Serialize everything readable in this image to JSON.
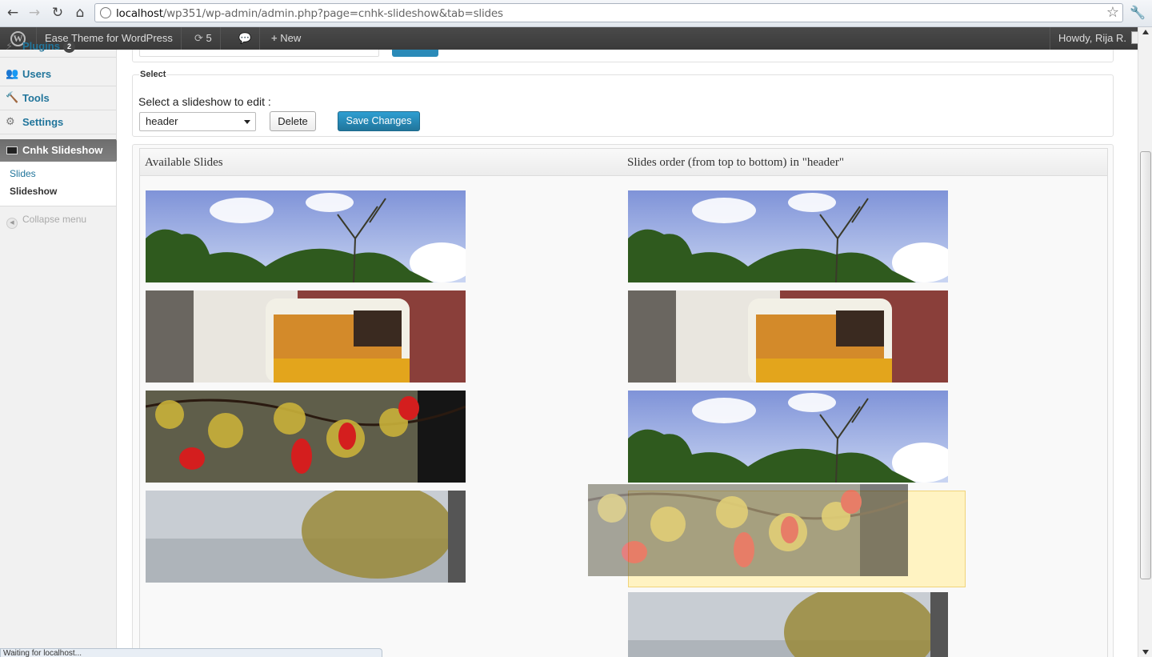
{
  "browser": {
    "url_host": "localhost",
    "url_rest": "/wp351/wp-admin/admin.php?page=cnhk-slideshow&tab=slides",
    "back_icon": "back-arrow-icon",
    "forward_icon": "forward-arrow-icon",
    "status": "Waiting for localhost..."
  },
  "adminbar": {
    "site_name": "Ease Theme for WordPress",
    "updates_count": "5",
    "new_label": "New",
    "howdy": "Howdy, Rija R."
  },
  "sidebar": {
    "items": [
      {
        "label": "Plugins",
        "badge": "2",
        "icon": "plugin-icon"
      },
      {
        "label": "Users",
        "icon": "users-icon"
      },
      {
        "label": "Tools",
        "icon": "tools-icon"
      },
      {
        "label": "Settings",
        "icon": "settings-icon"
      }
    ],
    "current": "Cnhk Slideshow",
    "submenu": [
      "Slides",
      "Slideshow"
    ],
    "collapse": "Collapse menu"
  },
  "select_section": {
    "legend": "Select",
    "label": "Select a slideshow to edit :",
    "selected": "header",
    "delete_label": "Delete",
    "save_label": "Save Changes"
  },
  "slides_panel": {
    "available_title": "Available Slides",
    "order_title": "Slides order (from top to bottom) in \"header\"",
    "available": [
      "sky-trees",
      "tram",
      "lanterns",
      "willow"
    ],
    "order": [
      "sky-trees",
      "tram",
      "sky-trees",
      "willow"
    ],
    "dragging": "lanterns"
  }
}
